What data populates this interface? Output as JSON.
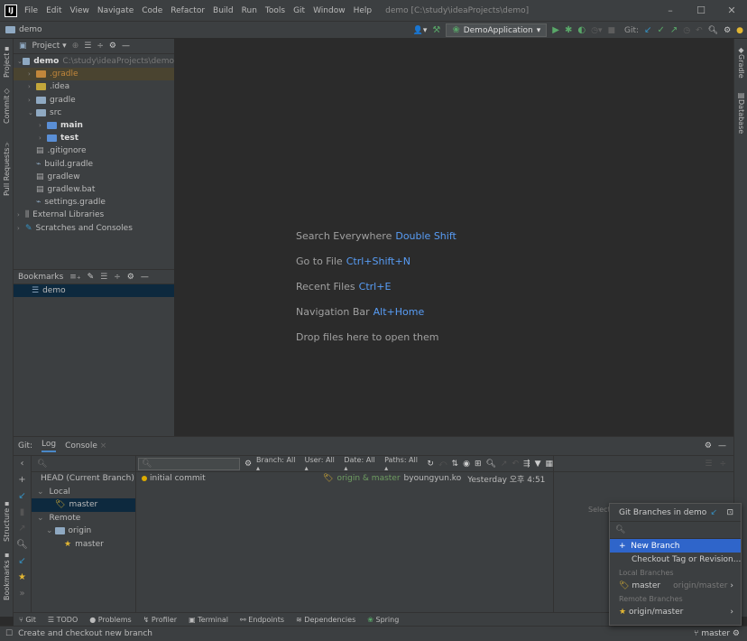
{
  "menubar": {
    "items": [
      "File",
      "Edit",
      "View",
      "Navigate",
      "Code",
      "Refactor",
      "Build",
      "Run",
      "Tools",
      "Git",
      "Window",
      "Help"
    ],
    "title": "demo [C:\\study\\ideaProjects\\demo]",
    "controls": [
      "–",
      "☐",
      "✕"
    ]
  },
  "navbar": {
    "project": "demo",
    "run_config": "DemoApplication",
    "git_label": "Git:"
  },
  "left_tabs": [
    "Project",
    "Commit",
    "Pull Requests",
    "Structure",
    "Bookmarks"
  ],
  "right_tabs": [
    "Gradle",
    "Database"
  ],
  "project_panel": {
    "header": "Project",
    "tree": [
      {
        "indent": 0,
        "arrow": "v",
        "icon": "module",
        "label": "demo",
        "extra": "C:\\study\\ideaProjects\\demo",
        "bold": true
      },
      {
        "indent": 1,
        "arrow": ">",
        "icon": "folder-orange",
        "label": ".gradle",
        "style": "hl"
      },
      {
        "indent": 1,
        "arrow": ">",
        "icon": "folder-yellow",
        "label": ".idea"
      },
      {
        "indent": 1,
        "arrow": ">",
        "icon": "folder",
        "label": "gradle"
      },
      {
        "indent": 1,
        "arrow": "v",
        "icon": "folder",
        "label": "src"
      },
      {
        "indent": 2,
        "arrow": ">",
        "icon": "folder-src",
        "label": "main",
        "bold": true
      },
      {
        "indent": 2,
        "arrow": ">",
        "icon": "folder-src",
        "label": "test",
        "bold": true
      },
      {
        "indent": 1,
        "arrow": "",
        "icon": "file",
        "label": ".gitignore"
      },
      {
        "indent": 1,
        "arrow": "",
        "icon": "gradle",
        "label": "build.gradle"
      },
      {
        "indent": 1,
        "arrow": "",
        "icon": "file",
        "label": "gradlew"
      },
      {
        "indent": 1,
        "arrow": "",
        "icon": "file",
        "label": "gradlew.bat"
      },
      {
        "indent": 1,
        "arrow": "",
        "icon": "gradle",
        "label": "settings.gradle"
      },
      {
        "indent": 0,
        "arrow": ">",
        "icon": "lib",
        "label": "External Libraries"
      },
      {
        "indent": 0,
        "arrow": ">",
        "icon": "scratch",
        "label": "Scratches and Consoles"
      }
    ]
  },
  "bookmarks_panel": {
    "header": "Bookmarks",
    "item": "demo"
  },
  "editor_hints": [
    {
      "text": "Search Everywhere",
      "key": "Double Shift"
    },
    {
      "text": "Go to File",
      "key": "Ctrl+Shift+N"
    },
    {
      "text": "Recent Files",
      "key": "Ctrl+E"
    },
    {
      "text": "Navigation Bar",
      "key": "Alt+Home"
    },
    {
      "text": "Drop files here to open them",
      "key": ""
    }
  ],
  "git_panel": {
    "tab_prefix": "Git:",
    "tabs": [
      "Log",
      "Console"
    ],
    "branches": [
      {
        "indent": 0,
        "arrow": "",
        "icon": "",
        "label": "HEAD (Current Branch)"
      },
      {
        "indent": 0,
        "arrow": "v",
        "icon": "",
        "label": "Local"
      },
      {
        "indent": 2,
        "arrow": "",
        "icon": "tag",
        "label": "master",
        "sel": true
      },
      {
        "indent": 0,
        "arrow": "v",
        "icon": "",
        "label": "Remote"
      },
      {
        "indent": 1,
        "arrow": "v",
        "icon": "folder",
        "label": "origin"
      },
      {
        "indent": 3,
        "arrow": "",
        "icon": "star",
        "label": "master"
      }
    ],
    "filters": [
      "Branch: All",
      "User: All",
      "Date: All",
      "Paths: All"
    ],
    "commit": {
      "message": "initial commit",
      "refs": "origin & master",
      "author": "byoungyun.ko",
      "date": "Yesterday 오후 4:51"
    },
    "detail_hint": "Select"
  },
  "bottom_tabs": [
    "Git",
    "TODO",
    "Problems",
    "Profiler",
    "Terminal",
    "Endpoints",
    "Dependencies",
    "Spring"
  ],
  "status": {
    "message": "Create and checkout new branch",
    "branch": "master"
  },
  "branch_popup": {
    "title": "Git Branches in demo",
    "actions": [
      "New Branch",
      "Checkout Tag or Revision..."
    ],
    "local_header": "Local Branches",
    "local": [
      {
        "name": "master",
        "track": "origin/master"
      }
    ],
    "remote_header": "Remote Branches",
    "remote": [
      {
        "name": "origin/master"
      }
    ]
  }
}
